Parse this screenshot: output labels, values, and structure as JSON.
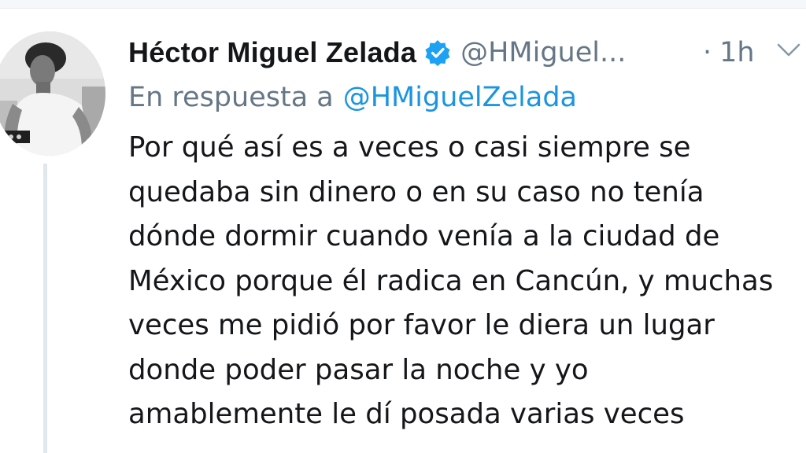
{
  "tweet": {
    "author": {
      "display_name": "Héctor Miguel Zelada",
      "handle": "@HMiguel...",
      "verified": true
    },
    "separator": "·",
    "time": "1h",
    "menu_icon": "chevron-down-icon",
    "reply_prefix": "En respuesta a",
    "reply_handle": "@HMiguelZelada",
    "body_lines": [
      "Por qué así es a veces o casi siempre se",
      "quedaba sin dinero o en su caso no tenía",
      "dónde dormir cuando venía a la ciudad de",
      "México porque él radica en Cancún, y muchas",
      "veces me pidió por favor le diera un lugar",
      "donde poder pasar la noche y yo",
      "amablemente le dí posada varias veces"
    ]
  },
  "colors": {
    "text": "#14171a",
    "secondary": "#657786",
    "link": "#1b95e0",
    "verified": "#1da1f2",
    "thread_line": "#e1e8ed"
  }
}
